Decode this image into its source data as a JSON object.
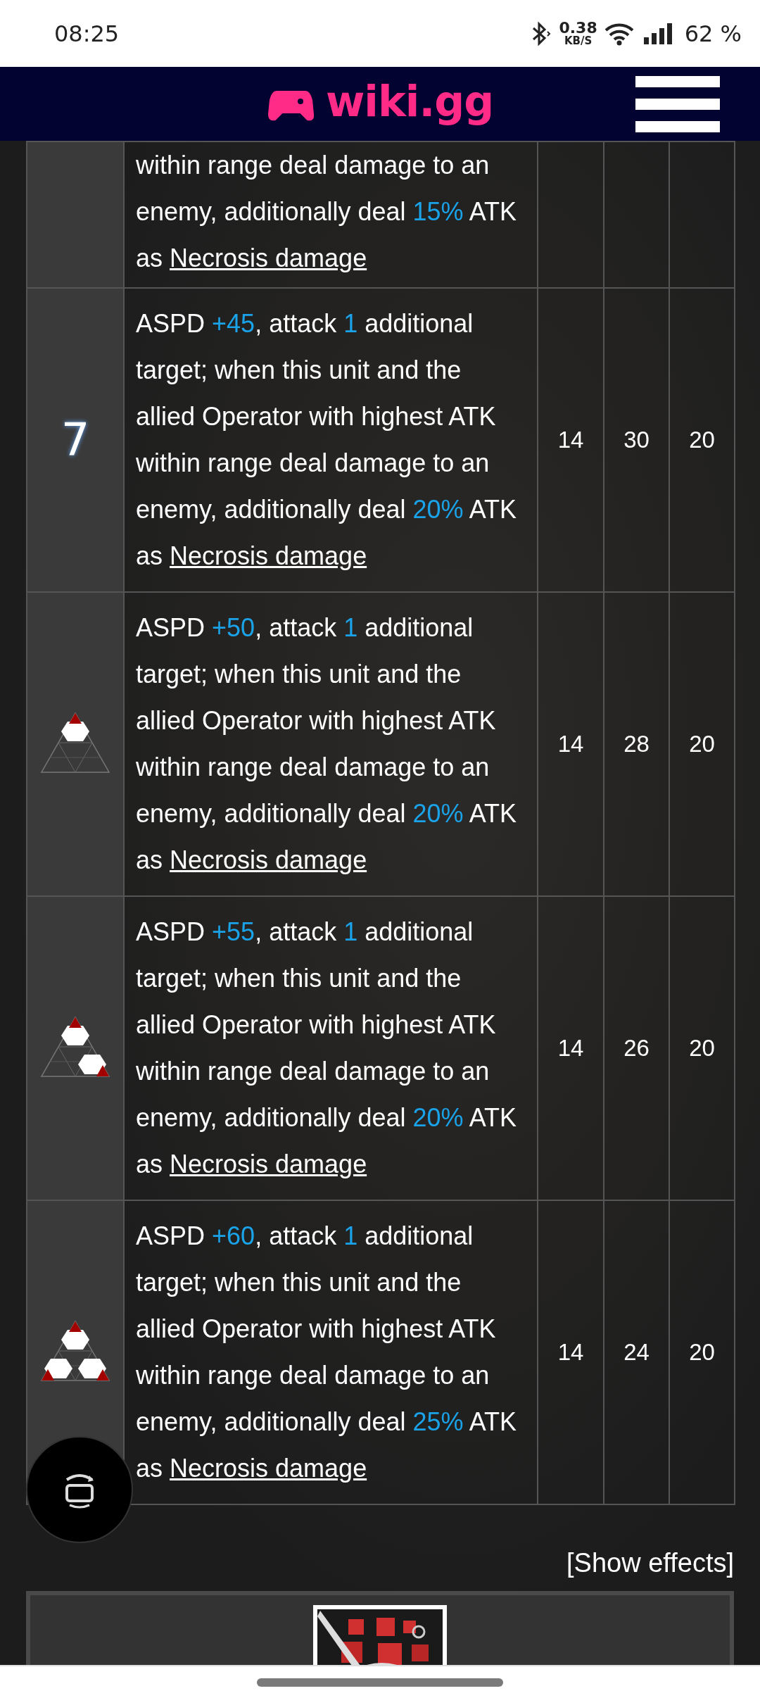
{
  "status_bar": {
    "time": "08:25",
    "net_speed": "0.38",
    "net_unit": "KB/S",
    "battery": "62 %"
  },
  "header": {
    "logo": "wiki.gg"
  },
  "table": {
    "rows": [
      {
        "kind": "partial",
        "description": [
          {
            "text": "within range deal damage to an enemy, additionally deal "
          },
          {
            "text": "15%",
            "kind": "value"
          },
          {
            "text": " ATK as "
          },
          {
            "text": "Necrosis damage",
            "kind": "link"
          }
        ]
      },
      {
        "kind": "full",
        "rank": {
          "kind": "level",
          "label": "7"
        },
        "description": [
          {
            "text": "ASPD "
          },
          {
            "text": "+45",
            "kind": "value"
          },
          {
            "text": ", attack "
          },
          {
            "text": "1",
            "kind": "value"
          },
          {
            "text": " additional target; when this unit and the allied Operator with highest ATK within range deal damage to an enemy, additionally deal "
          },
          {
            "text": "20%",
            "kind": "value"
          },
          {
            "text": " ATK as "
          },
          {
            "text": "Necrosis damage",
            "kind": "link"
          }
        ],
        "sp_cost": "14",
        "initial": "30",
        "duration": "20"
      },
      {
        "kind": "full",
        "rank": {
          "kind": "mastery1"
        },
        "description": [
          {
            "text": "ASPD "
          },
          {
            "text": "+50",
            "kind": "value"
          },
          {
            "text": ", attack "
          },
          {
            "text": "1",
            "kind": "value"
          },
          {
            "text": " additional target; when this unit and the allied Operator with highest ATK within range deal damage to an enemy, additionally deal "
          },
          {
            "text": "20%",
            "kind": "value"
          },
          {
            "text": " ATK as "
          },
          {
            "text": "Necrosis damage",
            "kind": "link"
          }
        ],
        "sp_cost": "14",
        "initial": "28",
        "duration": "20"
      },
      {
        "kind": "full",
        "rank": {
          "kind": "mastery2"
        },
        "description": [
          {
            "text": "ASPD "
          },
          {
            "text": "+55",
            "kind": "value"
          },
          {
            "text": ", attack "
          },
          {
            "text": "1",
            "kind": "value"
          },
          {
            "text": " additional target; when this unit and the allied Operator with highest ATK within range deal damage to an enemy, additionally deal "
          },
          {
            "text": "20%",
            "kind": "value"
          },
          {
            "text": " ATK as "
          },
          {
            "text": "Necrosis damage",
            "kind": "link"
          }
        ],
        "sp_cost": "14",
        "initial": "26",
        "duration": "20"
      },
      {
        "kind": "full",
        "rank": {
          "kind": "mastery3"
        },
        "description": [
          {
            "text": "ASPD "
          },
          {
            "text": "+60",
            "kind": "value"
          },
          {
            "text": ", attack "
          },
          {
            "text": "1",
            "kind": "value"
          },
          {
            "text": " additional target; when this unit and the allied Operator with highest ATK within range deal damage to an enemy, additionally deal "
          },
          {
            "text": "25%",
            "kind": "value"
          },
          {
            "text": " ATK as "
          },
          {
            "text": "Necrosis damage",
            "kind": "link"
          }
        ],
        "sp_cost": "14",
        "initial": "24",
        "duration": "20"
      }
    ]
  },
  "show_effects": "[Show effects]"
}
